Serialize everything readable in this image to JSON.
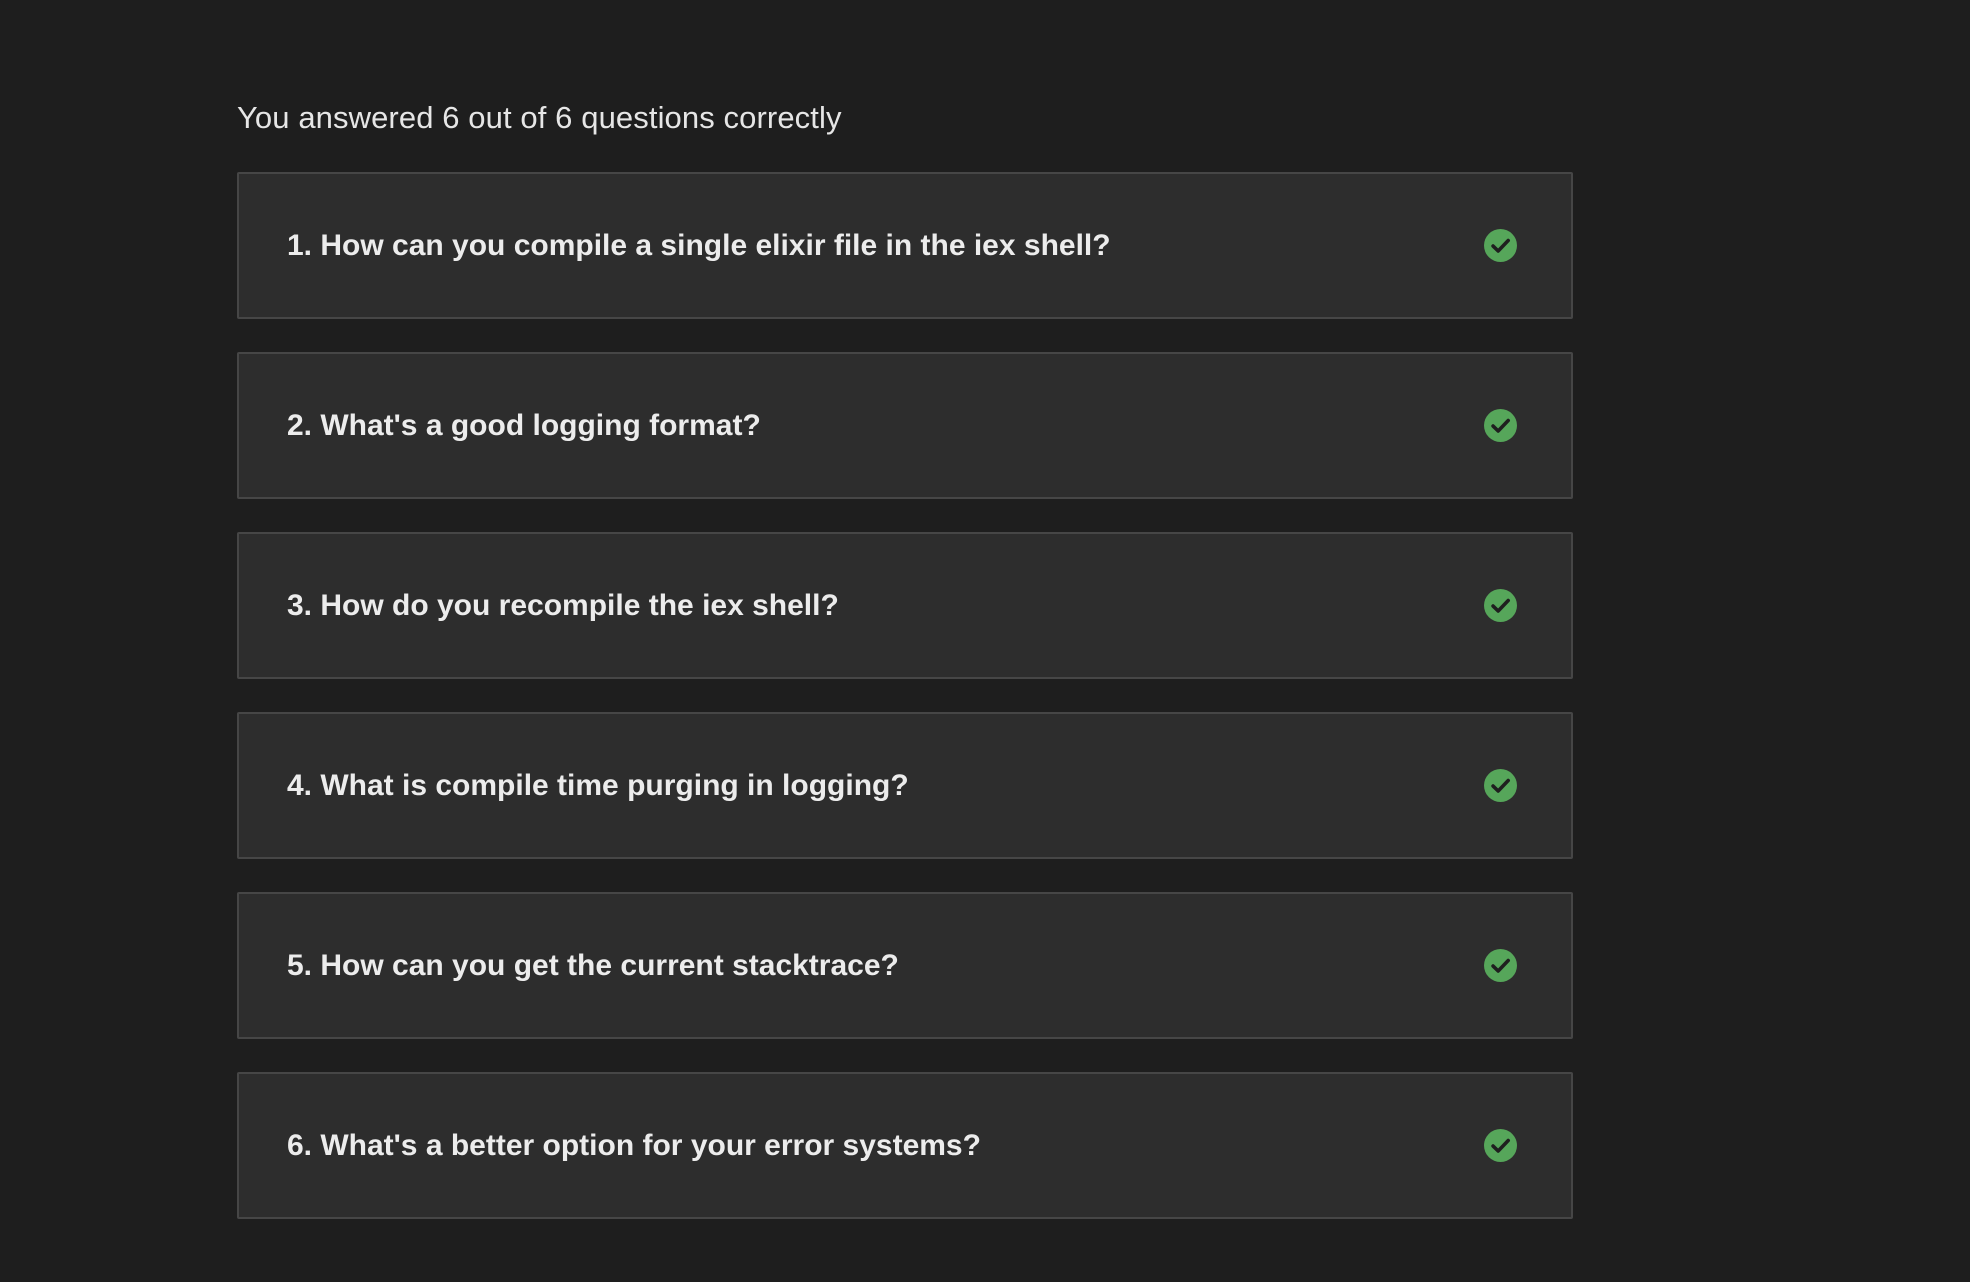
{
  "summary": "You answered 6 out of 6 questions correctly",
  "status_color": "#56a65a",
  "questions": [
    {
      "text": "1. How can you compile a single elixir file in the iex shell?",
      "status_icon": "check-circle-icon"
    },
    {
      "text": "2. What's a good logging format?",
      "status_icon": "check-circle-icon"
    },
    {
      "text": "3. How do you recompile the iex shell?",
      "status_icon": "check-circle-icon"
    },
    {
      "text": "4. What is compile time purging in logging?",
      "status_icon": "check-circle-icon"
    },
    {
      "text": "5. How can you get the current stacktrace?",
      "status_icon": "check-circle-icon"
    },
    {
      "text": "6. What's a better option for your error systems?",
      "status_icon": "check-circle-icon"
    }
  ]
}
